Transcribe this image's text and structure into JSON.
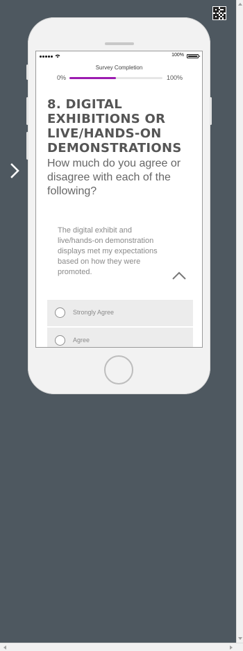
{
  "status_bar": {
    "battery_label": "100%"
  },
  "progress": {
    "title": "Survey Completion",
    "start_label": "0%",
    "end_label": "100%",
    "value_percent": 50,
    "fill_color": "#9b1bb0"
  },
  "question": {
    "title": "8. DIGITAL EXHIBITIONS OR LIVE/HANDS-ON DEMONSTRATIONS",
    "text": "How much do you agree or disagree with each of the following?"
  },
  "statement": {
    "text": "The digital exhibit and live/hands-on demonstration displays met my expectations based on how they were promoted."
  },
  "options": [
    {
      "label": "Strongly Agree"
    },
    {
      "label": "Agree"
    }
  ],
  "icons": {
    "nav": "chevron-right-icon",
    "collapse": "chevron-up-icon",
    "qr": "qr-code-icon",
    "wifi": "wifi-icon",
    "battery": "battery-icon",
    "signal": "signal-icon"
  },
  "colors": {
    "page_background": "#4e5860",
    "phone_body": "#f2f2f2",
    "accent": "#9b1bb0"
  }
}
